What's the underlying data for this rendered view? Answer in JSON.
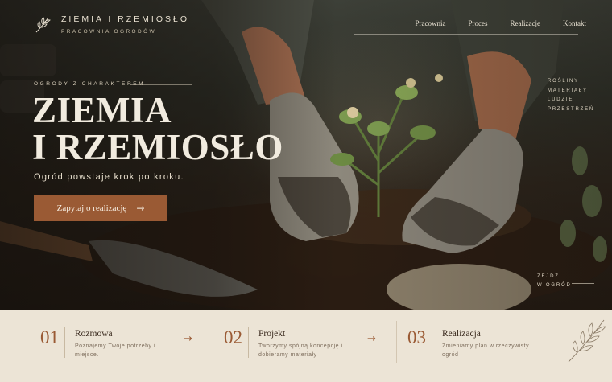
{
  "brand": {
    "title": "ZIEMIA I RZEMIOSŁO",
    "subtitle": "PRACOWNIA OGRODÓW"
  },
  "nav": {
    "items": [
      "Pracownia",
      "Proces",
      "Realizacje",
      "Kontakt"
    ]
  },
  "hero": {
    "eyebrow": "OGRODY Z CHARAKTEREM",
    "title_line1": "ZIEMIA",
    "title_line2": "I RZEMIOSŁO",
    "tagline": "Ogród powstaje krok po kroku.",
    "cta_label": "Zapytaj o realizację",
    "cta_arrow": "→"
  },
  "side_tags": [
    "ROŚLINY",
    "MATERIAŁY",
    "LUDZIE",
    "PRZESTRZEŃ"
  ],
  "scroll_tag": [
    "ZEJDŹ",
    "W OGRÓD"
  ],
  "steps": [
    {
      "number": "01",
      "title": "Rozmowa",
      "description": "Poznajemy Twoje potrzeby i miejsce.",
      "arrow": "→"
    },
    {
      "number": "02",
      "title": "Projekt",
      "description": "Tworzymy spójną koncepcję i dobieramy materiały",
      "arrow": "→"
    },
    {
      "number": "03",
      "title": "Realizacja",
      "description": "Zmieniamy plan w rzeczywisty ogród",
      "arrow": ""
    }
  ],
  "colors": {
    "accent": "#9a5a34",
    "steps_bg": "#ece4d6",
    "hero_text": "#f1ebdf"
  },
  "icons": {
    "logo": "leaf-sprig-icon",
    "cta": "arrow-right-icon",
    "steps": "arrow-right-icon",
    "decoration": "botanical-sprig-icon"
  }
}
